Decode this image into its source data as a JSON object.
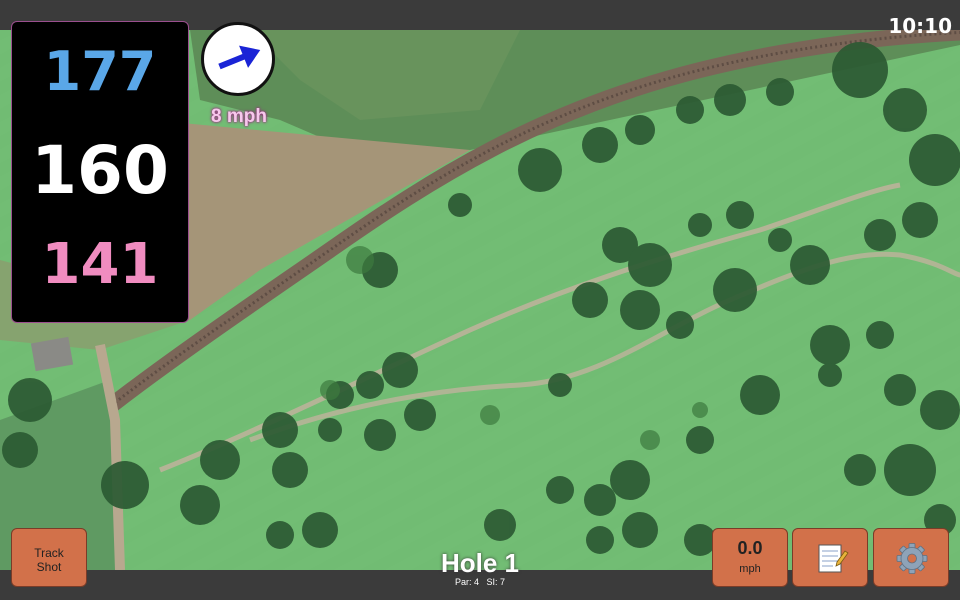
{
  "status": {
    "clock": "10:10"
  },
  "distances": {
    "back": "177",
    "center": "160",
    "front": "141"
  },
  "wind": {
    "speed_label": "8 mph",
    "icon": "wind-arrow-icon",
    "direction": "east-northeast"
  },
  "controls": {
    "track_shot_line1": "Track",
    "track_shot_line2": "Shot",
    "wind_value": "0.0",
    "wind_unit": "mph",
    "notes_icon": "memo-icon",
    "settings_icon": "gear-icon"
  },
  "hole": {
    "title": "Hole 1",
    "par": "Par: 4",
    "si": "SI: 7"
  },
  "colors": {
    "back_distance": "#5aa7e8",
    "center_distance": "#ffffff",
    "front_distance": "#f08cc0",
    "button": "#d2714a",
    "bar": "#3b3b3b"
  }
}
